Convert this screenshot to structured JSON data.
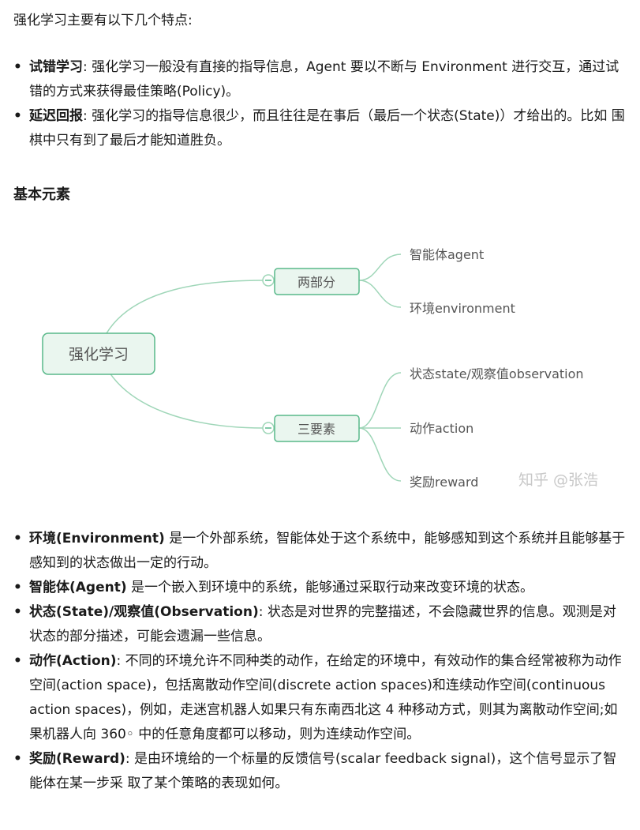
{
  "intro": "强化学习主要有以下几个特点:",
  "features": [
    {
      "term": "试错学习",
      "desc": ": 强化学习一般没有直接的指导信息，Agent 要以不断与 Environment 进行交互，通过试错的方式来获得最佳策略(Policy)。"
    },
    {
      "term": "延迟回报",
      "desc": ": 强化学习的指导信息很少，而且往往是在事后（最后一个状态(State)）才给出的。比如 围棋中只有到了最后才能知道胜负。"
    }
  ],
  "section_heading": "基本元素",
  "mindmap": {
    "root": "强化学习",
    "branch_top": "两部分",
    "branch_bottom": "三要素",
    "top_leaves": [
      "智能体agent",
      "环境environment"
    ],
    "bottom_leaves": [
      "状态state/观察值observation",
      "动作action",
      "奖励reward"
    ],
    "watermark": "知乎 @张浩",
    "colors": {
      "line": "#9fd6b8",
      "node_fill": "#eaf6ef",
      "node_border": "#59b98a",
      "text": "#555555",
      "watermark": "#c8c8c8"
    }
  },
  "elements": [
    {
      "term": "环境(Environment)",
      "desc": " 是一个外部系统，智能体处于这个系统中，能够感知到这个系统并且能够基于感知到的状态做出一定的行动。"
    },
    {
      "term": "智能体(Agent)",
      "desc": " 是一个嵌入到环境中的系统，能够通过采取行动来改变环境的状态。"
    },
    {
      "term": "状态(State)/观察值(Observation)",
      "desc": ": 状态是对世界的完整描述，不会隐藏世界的信息。观测是对状态的部分描述，可能会遗漏一些信息。"
    },
    {
      "term": "动作(Action)",
      "desc": ": 不同的环境允许不同种类的动作，在给定的环境中，有效动作的集合经常被称为动作空间(action space)，包括离散动作空间(discrete action spaces)和连续动作空间(continuous action spaces)，例如，走迷宫机器人如果只有东南西北这 4 种移动方式，则其为离散动作空间;如果机器人向 360◦ 中的任意角度都可以移动，则为连续动作空间。"
    },
    {
      "term": "奖励(Reward)",
      "desc": ": 是由环境给的一个标量的反馈信号(scalar feedback signal)，这个信号显示了智能体在某一步采 取了某个策略的表现如何。"
    }
  ]
}
